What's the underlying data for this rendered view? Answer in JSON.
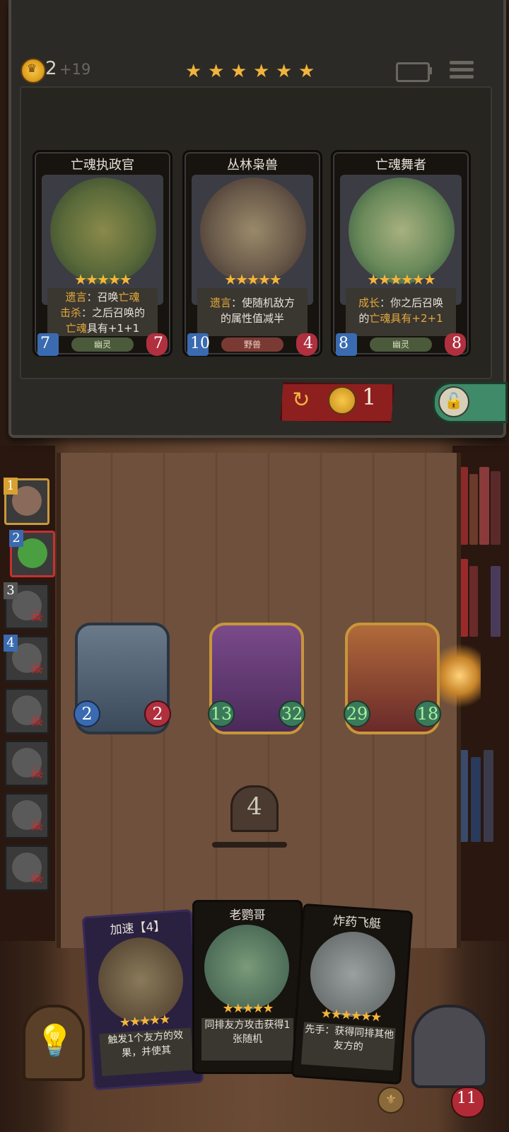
{
  "header": {
    "gold": "2",
    "gold_income": "+19",
    "tier_stars": [
      "★",
      "★",
      "★",
      "★",
      "★",
      "★"
    ]
  },
  "shop": {
    "cards": [
      {
        "name": "亡魂执政官",
        "stars": "★★★★★",
        "desc_lines": [
          [
            "遗言",
            "：召唤",
            "亡魂"
          ],
          [
            "击杀",
            "：之后召唤的",
            ""
          ],
          [
            "亡魂",
            "具有+1+1",
            ""
          ]
        ],
        "attack": "7",
        "health": "7",
        "tribe": "幽灵"
      },
      {
        "name": "丛林枭兽",
        "stars": "★★★★★",
        "desc_lines": [
          [
            "遗言",
            "：使随机敌方",
            ""
          ],
          [
            "",
            "的属性值减半",
            ""
          ]
        ],
        "attack": "10",
        "health": "4",
        "tribe": "野兽"
      },
      {
        "name": "亡魂舞者",
        "stars": "★★★★★★",
        "desc_lines": [
          [
            "成长",
            "：你之后召唤",
            ""
          ],
          [
            "",
            "的",
            "亡魂具有+2+1"
          ]
        ],
        "attack": "8",
        "health": "8",
        "tribe": "幽灵"
      }
    ],
    "refresh_cost": "1"
  },
  "turn_order": [
    "1",
    "2",
    "3",
    "4",
    "",
    "",
    "",
    ""
  ],
  "board": [
    {
      "attack": "2",
      "health": "2"
    },
    {
      "attack": "13",
      "health": "32"
    },
    {
      "attack": "29",
      "health": "18"
    }
  ],
  "turn": "4",
  "hand": [
    {
      "name": "加速【4】",
      "stars": "★★★★★",
      "desc": "触发1个友方的效果，并使其"
    },
    {
      "name": "老鹦哥",
      "stars": "★★★★★",
      "desc": "同排友方攻击获得1张随机"
    },
    {
      "name": "炸药飞艇",
      "stars": "★★★★★★",
      "desc": "先手：获得同排其他友方的"
    }
  ],
  "hero_health": "11",
  "colors": {
    "accent_gold": "#f2b440",
    "refresh_red": "#8e1f1f",
    "lock_green": "#3f8a68",
    "ghost_tribe": "#4a5a3a",
    "beast_tribe": "#7a3a34"
  },
  "icons": [
    "gold-coin-icon",
    "battery-icon",
    "menu-icon",
    "refresh-icon",
    "lock-icon",
    "skull-icon",
    "lightbulb-icon",
    "heart-icon"
  ]
}
